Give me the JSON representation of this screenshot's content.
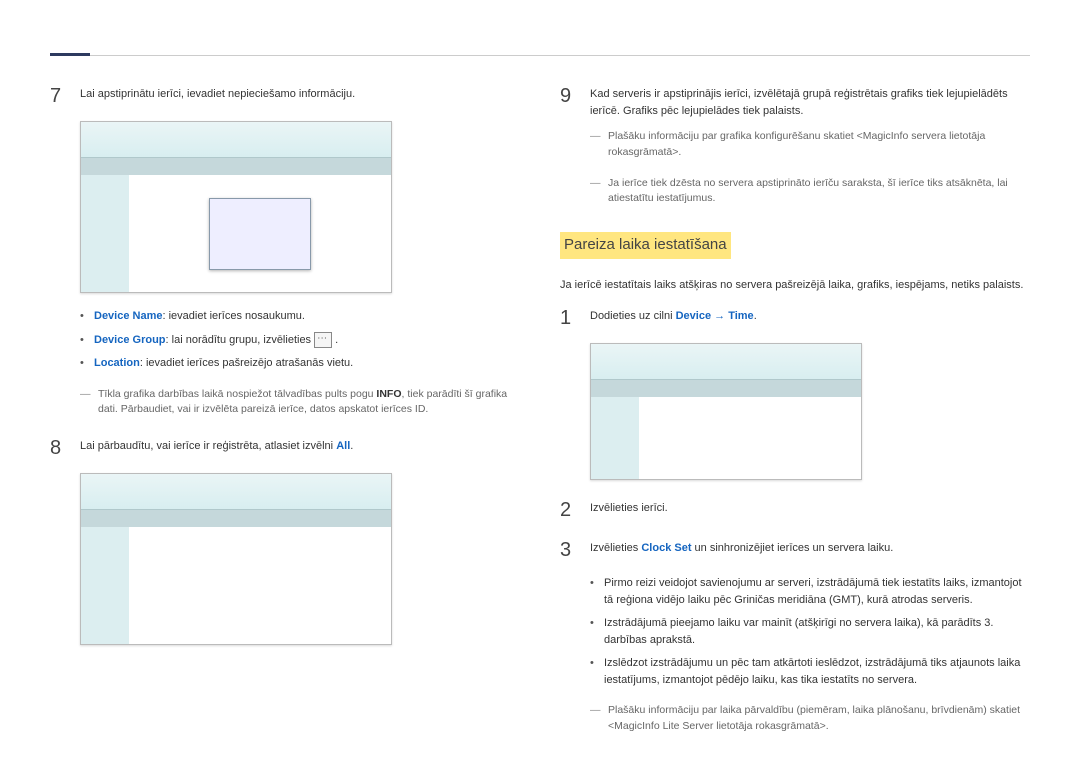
{
  "left": {
    "step7": {
      "num": "7",
      "text": "Lai apstiprinātu ierīci, ievadiet nepieciešamo informāciju."
    },
    "bullets": {
      "b1_label": "Device Name",
      "b1_text": ": ievadiet ierīces nosaukumu.",
      "b2_label": "Device Group",
      "b2_text": ": lai norādītu grupu, izvēlieties ",
      "b3_label": "Location",
      "b3_text": ": ievadiet ierīces pašreizējo atrašanās vietu."
    },
    "note7": "Tīkla grafika darbības laikā nospiežot tālvadības pults pogu ",
    "note7_bold": "INFO",
    "note7_tail": ", tiek parādīti šī grafika dati. Pārbaudiet, vai ir izvēlēta pareizā ierīce, datos apskatot ierīces ID.",
    "step8": {
      "num": "8",
      "text": "Lai pārbaudītu, vai ierīce ir reģistrēta, atlasiet izvēlni ",
      "bold": "All",
      "tail": "."
    }
  },
  "right": {
    "step9": {
      "num": "9",
      "text": "Kad serveris ir apstiprinājis ierīci, izvēlētajā grupā reģistrētais grafiks tiek lejupielādēts ierīcē. Grafiks pēc lejupielādes tiek palaists."
    },
    "note9a": "Plašāku informāciju par grafika konfigurēšanu skatiet <MagicInfo servera lietotāja rokasgrāmatā>.",
    "note9b": "Ja ierīce tiek dzēsta no servera apstiprināto ierīču saraksta, šī ierīce tiks atsāknēta, lai atiestatītu iestatījumus.",
    "heading": "Pareiza laika iestatīšana",
    "intro": "Ja ierīcē iestatītais laiks atšķiras no servera pašreizējā laika, grafiks, iespējams, netiks palaists.",
    "step1": {
      "num": "1",
      "pre": "Dodieties uz cilni ",
      "l1": "Device",
      "arrow": " → ",
      "l2": "Time",
      "tail": "."
    },
    "step2": {
      "num": "2",
      "text": "Izvēlieties ierīci."
    },
    "step3": {
      "num": "3",
      "pre": "Izvēlieties ",
      "bold": "Clock Set",
      "tail": " un sinhronizējiet ierīces un servera laiku."
    },
    "lbul": {
      "b1": "Pirmo reizi veidojot savienojumu ar serveri, izstrādājumā tiek iestatīts laiks, izmantojot tā reģiona vidējo laiku pēc Griničas meridiāna (GMT), kurā atrodas serveris.",
      "b2": "Izstrādājumā pieejamo laiku var mainīt (atšķirīgi no servera laika), kā parādīts 3. darbības aprakstā.",
      "b3": "Izslēdzot izstrādājumu un pēc tam atkārtoti ieslēdzot, izstrādājumā tiks atjaunots laika iestatījums, izmantojot pēdējo laiku, kas tika iestatīts no servera."
    },
    "lastnote": "Plašāku informāciju par laika pārvaldību (piemēram, laika plānošanu, brīvdienām) skatiet <MagicInfo Lite Server lietotāja rokasgrāmatā>."
  }
}
